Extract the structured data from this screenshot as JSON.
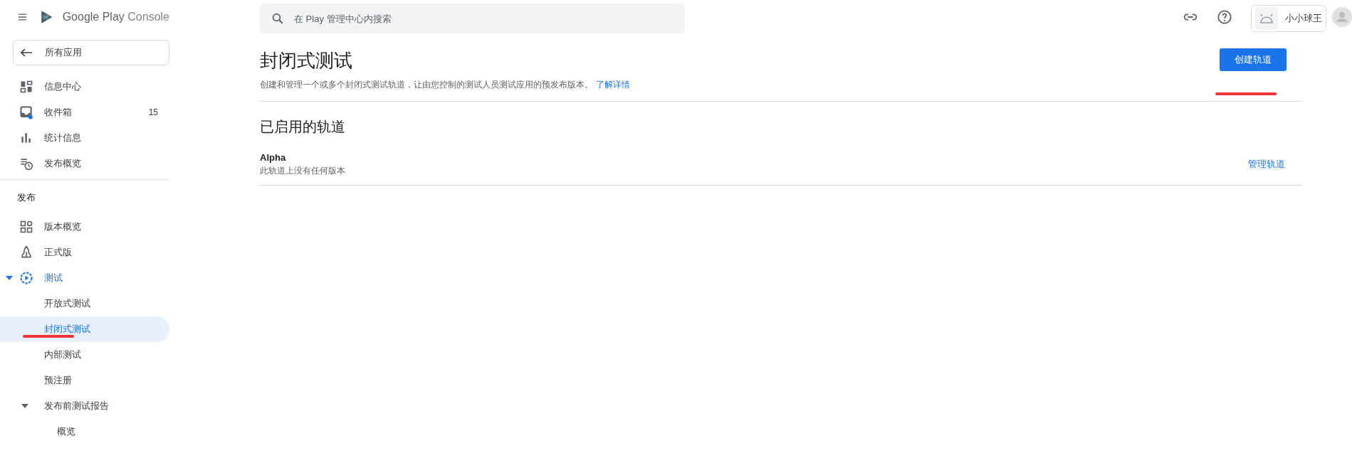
{
  "header": {
    "brand": "Google Play",
    "product": "Console"
  },
  "back_button": {
    "label": "所有应用"
  },
  "nav_main": [
    {
      "label": "信息中心",
      "selected": false
    },
    {
      "label": "收件箱",
      "badge": "15",
      "selected": false
    },
    {
      "label": "统计信息",
      "selected": false
    },
    {
      "label": "发布概览",
      "selected": false
    }
  ],
  "nav_section": {
    "title": "发布"
  },
  "nav_release": [
    {
      "label": "版本概览",
      "selected": false
    },
    {
      "label": "正式版",
      "selected": false
    },
    {
      "label": "测试",
      "selected": false,
      "expanded": true,
      "children": [
        {
          "label": "开放式测试",
          "selected": false
        },
        {
          "label": "封闭式测试",
          "selected": true
        },
        {
          "label": "内部测试",
          "selected": false
        },
        {
          "label": "预注册",
          "selected": false
        },
        {
          "label": "发布前测试报告",
          "selected": false,
          "expanded": true,
          "children": [
            {
              "label": "概览",
              "selected": false
            }
          ]
        }
      ]
    }
  ],
  "search": {
    "placeholder": "在 Play 管理中心内搜索"
  },
  "account": {
    "name": "小小球王"
  },
  "page": {
    "title": "封闭式测试",
    "description": "创建和管理一个或多个封闭式测试轨道，让由您控制的测试人员测试应用的预发布版本。",
    "learn_more": "了解详情",
    "create_button": "创建轨道",
    "section_title": "已启用的轨道",
    "tracks": [
      {
        "name": "Alpha",
        "status": "此轨道上没有任何版本",
        "action": "管理轨道"
      }
    ]
  }
}
